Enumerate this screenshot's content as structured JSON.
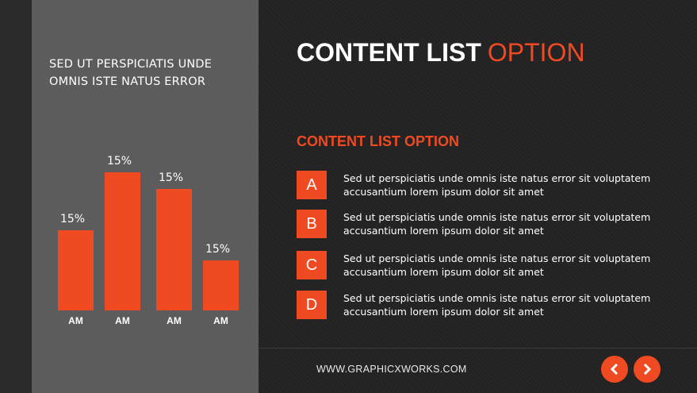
{
  "panel": {
    "heading_line1": "SED UT PERSPICIATIS UNDE",
    "heading_line2": "OMNIS ISTE NATUS ERROR"
  },
  "chart_data": {
    "type": "bar",
    "categories": [
      "AM",
      "AM",
      "AM",
      "AM"
    ],
    "values": [
      15,
      15,
      15,
      15
    ],
    "data_labels": [
      "15%",
      "15%",
      "15%",
      "15%"
    ],
    "relative_heights": [
      0.58,
      1.0,
      0.88,
      0.36
    ],
    "bar_color": "#f04a22",
    "title": "",
    "xlabel": "",
    "ylabel": ""
  },
  "title": {
    "part1": "CONTENT LIST",
    "part2": "OPTION"
  },
  "subtitle": "CONTENT LIST OPTION",
  "items": [
    {
      "letter": "A",
      "line1": "Sed ut perspiciatis unde omnis iste natus error sit voluptatem",
      "line2": "accusantium lorem ipsum dolor sit amet"
    },
    {
      "letter": "B",
      "line1": "Sed ut perspiciatis unde omnis iste natus error sit voluptatem",
      "line2": "accusantium lorem ipsum dolor sit amet"
    },
    {
      "letter": "C",
      "line1": "Sed ut perspiciatis unde omnis iste natus error sit voluptatem",
      "line2": "accusantium lorem ipsum dolor sit amet"
    },
    {
      "letter": "D",
      "line1": "Sed ut perspiciatis unde omnis iste natus error sit voluptatem",
      "line2": "accusantium lorem ipsum dolor sit amet"
    }
  ],
  "footer": {
    "url": "WWW.GRAPHICXWORKS.COM"
  },
  "nav": {
    "prev_icon": "chevron-left-icon",
    "next_icon": "chevron-right-icon"
  },
  "colors": {
    "accent": "#f04a22",
    "background": "#232323",
    "panel": "#5c5c5c"
  }
}
